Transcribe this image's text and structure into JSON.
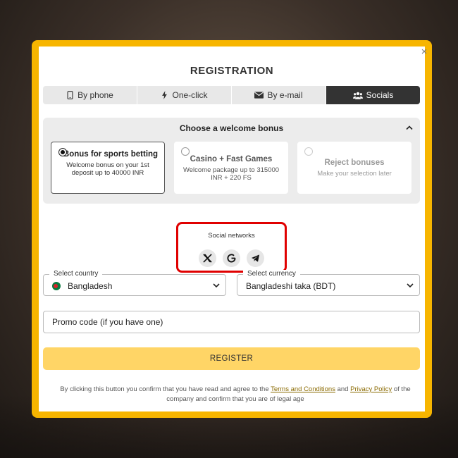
{
  "modal": {
    "title": "REGISTRATION",
    "close_glyph": "×"
  },
  "tabs": [
    {
      "label": "By phone",
      "icon": "phone-icon",
      "active": false
    },
    {
      "label": "One-click",
      "icon": "lightning-icon",
      "active": false
    },
    {
      "label": "By e-mail",
      "icon": "envelope-icon",
      "active": false
    },
    {
      "label": "Socials",
      "icon": "users-icon",
      "active": true
    }
  ],
  "bonus": {
    "heading": "Choose a welcome bonus",
    "options": [
      {
        "title": "Bonus for sports betting",
        "desc": "Welcome bonus on your 1st deposit up to 40000 INR",
        "selected": true
      },
      {
        "title": "Casino + Fast Games",
        "desc": "Welcome package up to 315000 INR + 220 FS",
        "selected": false
      },
      {
        "title": "Reject bonuses",
        "desc": "Make your selection later",
        "selected": false
      }
    ]
  },
  "social": {
    "label": "Social networks",
    "networks": [
      "x-icon",
      "google-icon",
      "telegram-icon"
    ]
  },
  "country": {
    "legend": "Select country",
    "value": "Bangladesh"
  },
  "currency": {
    "legend": "Select currency",
    "value": "Bangladeshi taka (BDT)"
  },
  "promo": {
    "placeholder": "Promo code (if you have one)"
  },
  "register": {
    "label": "REGISTER"
  },
  "terms": {
    "prefix": "By clicking this button you confirm that you have read and agree to the",
    "link1": "Terms and Conditions",
    "and": "and",
    "link2": "Privacy Policy",
    "suffix": "of the company and confirm that you are of legal age"
  },
  "colors": {
    "frame": "#f7b500",
    "active_tab": "#333333",
    "register_btn": "#ffd566",
    "highlight": "#e00000"
  }
}
